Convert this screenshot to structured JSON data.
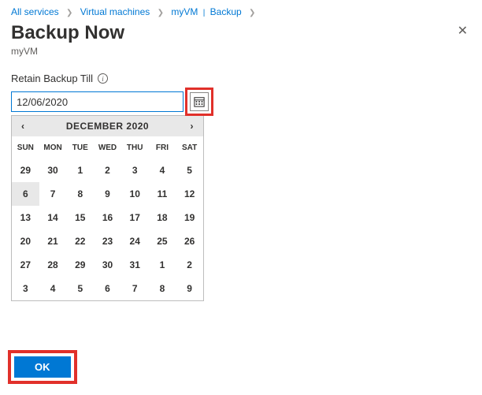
{
  "breadcrumb": {
    "all_services": "All services",
    "virtual_machines": "Virtual machines",
    "vm_name": "myVM",
    "backup": "Backup"
  },
  "header": {
    "title": "Backup Now",
    "subtitle": "myVM"
  },
  "field": {
    "label": "Retain Backup Till",
    "value": "12/06/2020"
  },
  "calendar": {
    "month_label": "DECEMBER 2020",
    "dow": [
      "SUN",
      "MON",
      "TUE",
      "WED",
      "THU",
      "FRI",
      "SAT"
    ],
    "weeks": [
      [
        "29",
        "30",
        "1",
        "2",
        "3",
        "4",
        "5"
      ],
      [
        "6",
        "7",
        "8",
        "9",
        "10",
        "11",
        "12"
      ],
      [
        "13",
        "14",
        "15",
        "16",
        "17",
        "18",
        "19"
      ],
      [
        "20",
        "21",
        "22",
        "23",
        "24",
        "25",
        "26"
      ],
      [
        "27",
        "28",
        "29",
        "30",
        "31",
        "1",
        "2"
      ],
      [
        "3",
        "4",
        "5",
        "6",
        "7",
        "8",
        "9"
      ]
    ],
    "selected": "6"
  },
  "actions": {
    "ok": "OK"
  }
}
